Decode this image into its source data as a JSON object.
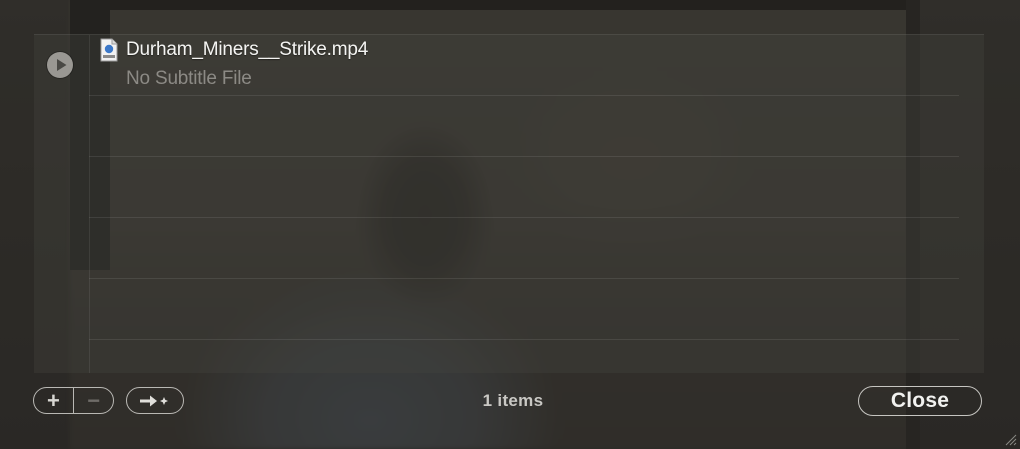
{
  "file_list": {
    "items": [
      {
        "file_name": "Durham_Miners__Strike.mp4",
        "subtitle_status": "No Subtitle File",
        "icon": "video-file-icon"
      }
    ]
  },
  "toolbar": {
    "add_label": "+",
    "remove_label": "−",
    "action_icon": "arrow-sparkle-icon",
    "item_count": "1 items",
    "close_label": "Close"
  },
  "colors": {
    "text_primary": "#f4f4f2",
    "text_secondary": "#8c8a85",
    "button_border": "#b9b8b4"
  }
}
